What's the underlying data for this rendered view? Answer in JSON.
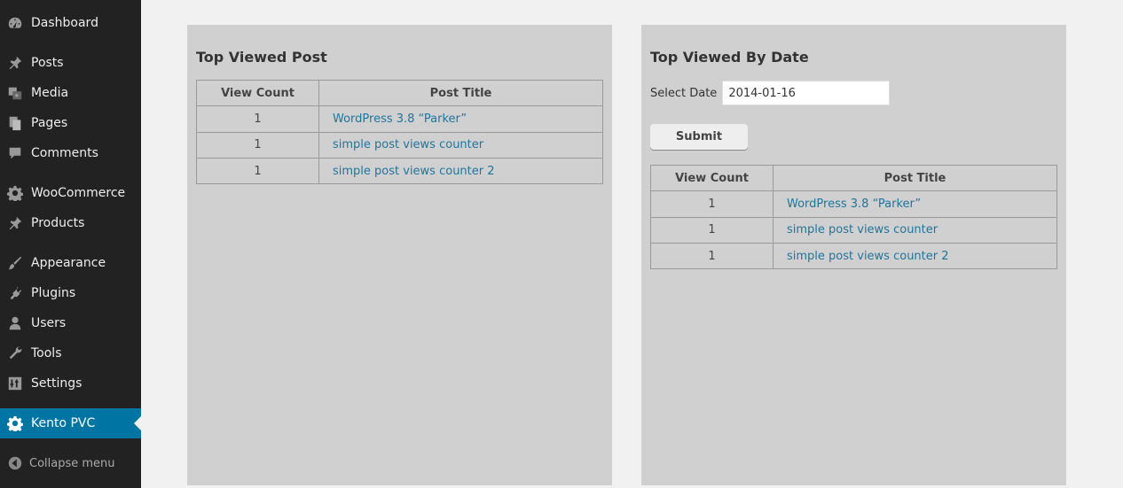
{
  "sidebar": {
    "items": [
      {
        "label": "Dashboard",
        "icon": "dashboard-icon"
      },
      {
        "label": "Posts",
        "icon": "pin-icon"
      },
      {
        "label": "Media",
        "icon": "media-icon"
      },
      {
        "label": "Pages",
        "icon": "pages-icon"
      },
      {
        "label": "Comments",
        "icon": "comment-icon"
      },
      {
        "label": "WooCommerce",
        "icon": "gear-icon"
      },
      {
        "label": "Products",
        "icon": "pin-icon"
      },
      {
        "label": "Appearance",
        "icon": "brush-icon"
      },
      {
        "label": "Plugins",
        "icon": "plug-icon"
      },
      {
        "label": "Users",
        "icon": "user-icon"
      },
      {
        "label": "Tools",
        "icon": "wrench-icon"
      },
      {
        "label": "Settings",
        "icon": "settings-icon"
      },
      {
        "label": "Kento PVC",
        "icon": "gear-icon",
        "active": true
      }
    ],
    "collapse_label": "Collapse menu"
  },
  "colors": {
    "sidebar_bg": "#222222",
    "active_bg": "#0074a2",
    "link": "#21759b",
    "panel_bg": "#d0d0d0"
  },
  "left_panel": {
    "title": "Top Viewed Post",
    "headers": [
      "View Count",
      "Post Title"
    ],
    "rows": [
      {
        "count": "1",
        "title": "WordPress 3.8 “Parker”"
      },
      {
        "count": "1",
        "title": "simple post views counter"
      },
      {
        "count": "1",
        "title": "simple post views counter 2"
      }
    ]
  },
  "right_panel": {
    "title": "Top Viewed By Date",
    "date_label": "Select Date",
    "date_value": "2014-01-16",
    "submit_label": "Submit",
    "headers": [
      "View Count",
      "Post Title"
    ],
    "rows": [
      {
        "count": "1",
        "title": "WordPress 3.8 “Parker”"
      },
      {
        "count": "1",
        "title": "simple post views counter"
      },
      {
        "count": "1",
        "title": "simple post views counter 2"
      }
    ]
  }
}
